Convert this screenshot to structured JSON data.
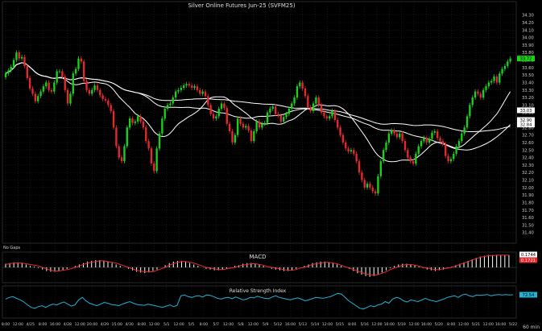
{
  "title": "Silver Online Futures Jun-25 (SVFM25)",
  "no_gaps_label": "No Gaps",
  "macd_label": "MACD",
  "rsi_label": "Relative Strength Index",
  "interval_label": "60 min",
  "colors": {
    "background": "#000000",
    "grid": "#2a2a2a",
    "up": "#19d219",
    "down": "#e8282d",
    "sma": "#ffffff",
    "rsi": "#1fb4d8",
    "macd_hist": "#ffffff",
    "macd_signal": "#e8282d"
  },
  "chart_data": [
    {
      "type": "candlestick",
      "title": "Silver Online Futures Jun-25 (SVFM25)",
      "ylim": [
        31.3,
        34.35
      ],
      "y_ticks": [
        "34.30",
        "34.20",
        "34.10",
        "34.00",
        "33.90",
        "33.80",
        "33.70",
        "33.60",
        "33.50",
        "33.40",
        "33.30",
        "33.20",
        "33.10",
        "33.00",
        "32.90",
        "32.80",
        "32.70",
        "32.60",
        "32.50",
        "32.40",
        "32.30",
        "32.20",
        "32.10",
        "32.00",
        "31.90",
        "31.80",
        "31.70",
        "31.60",
        "31.50",
        "31.40"
      ],
      "right_labels": [
        {
          "value": 33.72,
          "text": "33.72",
          "style": "last"
        },
        {
          "value": 33.03,
          "text": "33.03",
          "style": "sma"
        },
        {
          "value": 32.9,
          "text": "32.90",
          "style": "sma"
        },
        {
          "value": 32.84,
          "text": "32.84",
          "style": "sma"
        }
      ],
      "x_labels": [
        "8:00",
        "12:00",
        "4/25",
        "8:00",
        "16:00",
        "4/28",
        "12:00",
        "20:00",
        "4/29",
        "15:00",
        "4/30",
        "8:00",
        "12:00",
        "5/1",
        "12:00",
        "5/5",
        "8:00",
        "5/7",
        "12:00",
        "5/8",
        "12:00",
        "5/9",
        "5/12",
        "16:00",
        "5/13",
        "5/14",
        "12:00",
        "5/15",
        "8:00",
        "5/16",
        "12:00",
        "16:00",
        "5/19",
        "12:00",
        "16:00",
        "5/20",
        "8:00",
        "12:00",
        "5/21",
        "12:00",
        "16:00",
        "5/22"
      ],
      "closes": [
        33.52,
        33.56,
        33.61,
        33.7,
        33.8,
        33.72,
        33.74,
        33.62,
        33.46,
        33.32,
        33.25,
        33.15,
        33.22,
        33.28,
        33.35,
        33.4,
        33.3,
        33.28,
        33.4,
        33.55,
        33.55,
        33.48,
        33.3,
        33.12,
        33.25,
        33.52,
        33.58,
        33.72,
        33.68,
        33.42,
        33.3,
        33.25,
        33.3,
        33.36,
        33.3,
        33.23,
        33.18,
        33.16,
        33.1,
        33.02,
        32.8,
        32.55,
        32.4,
        32.35,
        32.55,
        32.8,
        32.92,
        32.86,
        32.88,
        32.95,
        32.88,
        32.8,
        32.62,
        32.52,
        32.32,
        32.22,
        32.52,
        32.72,
        32.92,
        33.05,
        33.1,
        33.12,
        33.2,
        33.28,
        33.3,
        33.33,
        33.36,
        33.38,
        33.36,
        33.33,
        33.35,
        33.3,
        33.25,
        33.28,
        33.22,
        33.1,
        32.98,
        32.92,
        32.95,
        33.05,
        33.12,
        33.06,
        32.85,
        32.75,
        32.6,
        32.7,
        32.92,
        32.85,
        32.8,
        32.82,
        32.76,
        32.62,
        32.75,
        32.88,
        32.8,
        32.85,
        32.86,
        33.0,
        33.05,
        33.08,
        32.98,
        32.96,
        32.88,
        32.94,
        32.98,
        33.05,
        33.12,
        33.2,
        33.35,
        33.4,
        33.32,
        33.22,
        33.07,
        33.02,
        33.12,
        33.2,
        33.1,
        33.0,
        32.95,
        32.92,
        32.95,
        33.02,
        32.9,
        32.8,
        32.7,
        32.6,
        32.52,
        32.48,
        32.5,
        32.45,
        32.35,
        32.2,
        32.1,
        32.0,
        32.05,
        32.0,
        31.95,
        31.92,
        32.15,
        32.35,
        32.5,
        32.6,
        32.72,
        32.76,
        32.72,
        32.67,
        32.72,
        32.62,
        32.5,
        32.4,
        32.35,
        32.32,
        32.45,
        32.55,
        32.62,
        32.66,
        32.6,
        32.65,
        32.73,
        32.75,
        32.66,
        32.62,
        32.58,
        32.42,
        32.35,
        32.38,
        32.45,
        32.55,
        32.62,
        32.72,
        32.8,
        32.95,
        33.1,
        33.2,
        33.28,
        33.25,
        33.2,
        33.3,
        33.35,
        33.4,
        33.42,
        33.48,
        33.4,
        33.52,
        33.58,
        33.62,
        33.68,
        33.72
      ]
    },
    {
      "type": "bar",
      "title": "MACD",
      "right_labels": [
        {
          "text": "0.1744",
          "style": "hist"
        },
        {
          "text": "0.1721",
          "style": "signal"
        }
      ],
      "values": [
        0.05,
        0.06,
        0.07,
        0.07,
        0.06,
        0.04,
        0.02,
        0.01,
        -0.01,
        -0.03,
        -0.05,
        -0.06,
        -0.06,
        -0.05,
        -0.04,
        -0.02,
        0.0,
        0.02,
        0.04,
        0.06,
        0.08,
        0.09,
        0.1,
        0.1,
        0.09,
        0.08,
        0.06,
        0.04,
        0.02,
        0.0,
        -0.02,
        -0.04,
        -0.06,
        -0.07,
        -0.08,
        -0.07,
        -0.05,
        -0.03,
        0.0,
        0.03,
        0.06,
        0.08,
        0.09,
        0.09,
        0.08,
        0.06,
        0.04,
        0.02,
        0.0,
        -0.02,
        -0.03,
        -0.04,
        -0.04,
        -0.03,
        -0.02,
        0.0,
        0.02,
        0.03,
        0.05,
        0.06,
        0.06,
        0.05,
        0.04,
        0.02,
        0.0,
        -0.02,
        -0.03,
        -0.04,
        -0.05,
        -0.05,
        -0.04,
        -0.02,
        0.0,
        0.02,
        0.04,
        0.06,
        0.07,
        0.08,
        0.08,
        0.07,
        0.06,
        0.04,
        0.02,
        0.0,
        -0.02,
        -0.05,
        -0.08,
        -0.1,
        -0.12,
        -0.13,
        -0.12,
        -0.1,
        -0.07,
        -0.04,
        -0.01,
        0.02,
        0.04,
        0.05,
        0.05,
        0.04,
        0.03,
        0.01,
        -0.01,
        -0.03,
        -0.04,
        -0.05,
        -0.04,
        -0.03,
        -0.01,
        0.01,
        0.03,
        0.05,
        0.07,
        0.09,
        0.11,
        0.13,
        0.15,
        0.16,
        0.17,
        0.17,
        0.17,
        0.17,
        0.17,
        0.17
      ],
      "signal": [
        0.04,
        0.05,
        0.06,
        0.06,
        0.06,
        0.05,
        0.04,
        0.03,
        0.02,
        0.0,
        -0.02,
        -0.04,
        -0.05,
        -0.05,
        -0.04,
        -0.03,
        -0.02,
        0.0,
        0.02,
        0.04,
        0.06,
        0.07,
        0.08,
        0.09,
        0.09,
        0.08,
        0.07,
        0.06,
        0.04,
        0.02,
        0.0,
        -0.02,
        -0.04,
        -0.05,
        -0.06,
        -0.06,
        -0.06,
        -0.04,
        -0.02,
        0.0,
        0.03,
        0.05,
        0.07,
        0.08,
        0.08,
        0.07,
        0.06,
        0.04,
        0.02,
        0.0,
        -0.01,
        -0.02,
        -0.03,
        -0.03,
        -0.02,
        -0.01,
        0.0,
        0.02,
        0.03,
        0.04,
        0.05,
        0.05,
        0.04,
        0.03,
        0.01,
        0.0,
        -0.01,
        -0.02,
        -0.03,
        -0.04,
        -0.04,
        -0.03,
        -0.01,
        0.0,
        0.02,
        0.04,
        0.05,
        0.06,
        0.07,
        0.07,
        0.06,
        0.05,
        0.03,
        0.01,
        -0.01,
        -0.03,
        -0.05,
        -0.07,
        -0.09,
        -0.1,
        -0.11,
        -0.1,
        -0.08,
        -0.06,
        -0.03,
        -0.01,
        0.01,
        0.03,
        0.04,
        0.04,
        0.03,
        0.02,
        0.0,
        -0.01,
        -0.02,
        -0.03,
        -0.03,
        -0.02,
        -0.01,
        0.0,
        0.02,
        0.04,
        0.06,
        0.08,
        0.1,
        0.12,
        0.14,
        0.15,
        0.16,
        0.16,
        0.17,
        0.17,
        0.17,
        0.17
      ]
    },
    {
      "type": "line",
      "title": "Relative Strength Index",
      "ylim": [
        0,
        100
      ],
      "right_labels": [
        {
          "text": "72.54",
          "style": "rsi"
        }
      ],
      "values": [
        62,
        66,
        68,
        64,
        60,
        55,
        48,
        42,
        40,
        44,
        46,
        42,
        47,
        50,
        48,
        52,
        55,
        50,
        45,
        48,
        60,
        66,
        58,
        52,
        49,
        46,
        50,
        54,
        52,
        49,
        48,
        46,
        50,
        53,
        56,
        52,
        49,
        48,
        47,
        50,
        48,
        46,
        44,
        42,
        45,
        48,
        44,
        47,
        70,
        72,
        68,
        66,
        69,
        70,
        67,
        72,
        71,
        68,
        64,
        62,
        65,
        66,
        63,
        67,
        64,
        60,
        62,
        66,
        65,
        69,
        66,
        64,
        63,
        67,
        70,
        66,
        64,
        62,
        60,
        63,
        65,
        62,
        58,
        60,
        63,
        66,
        65,
        64,
        66,
        68,
        72,
        76,
        74,
        66,
        58,
        52,
        46,
        40,
        38,
        42,
        46,
        44,
        48,
        50,
        56,
        52,
        62,
        66,
        64,
        58,
        55,
        60,
        58,
        56,
        60,
        64,
        60,
        58,
        56,
        59,
        62,
        66,
        68,
        70,
        66,
        72,
        74,
        70,
        68,
        72,
        71,
        72,
        73,
        70,
        72,
        73,
        72,
        73,
        72,
        72.5
      ]
    }
  ]
}
